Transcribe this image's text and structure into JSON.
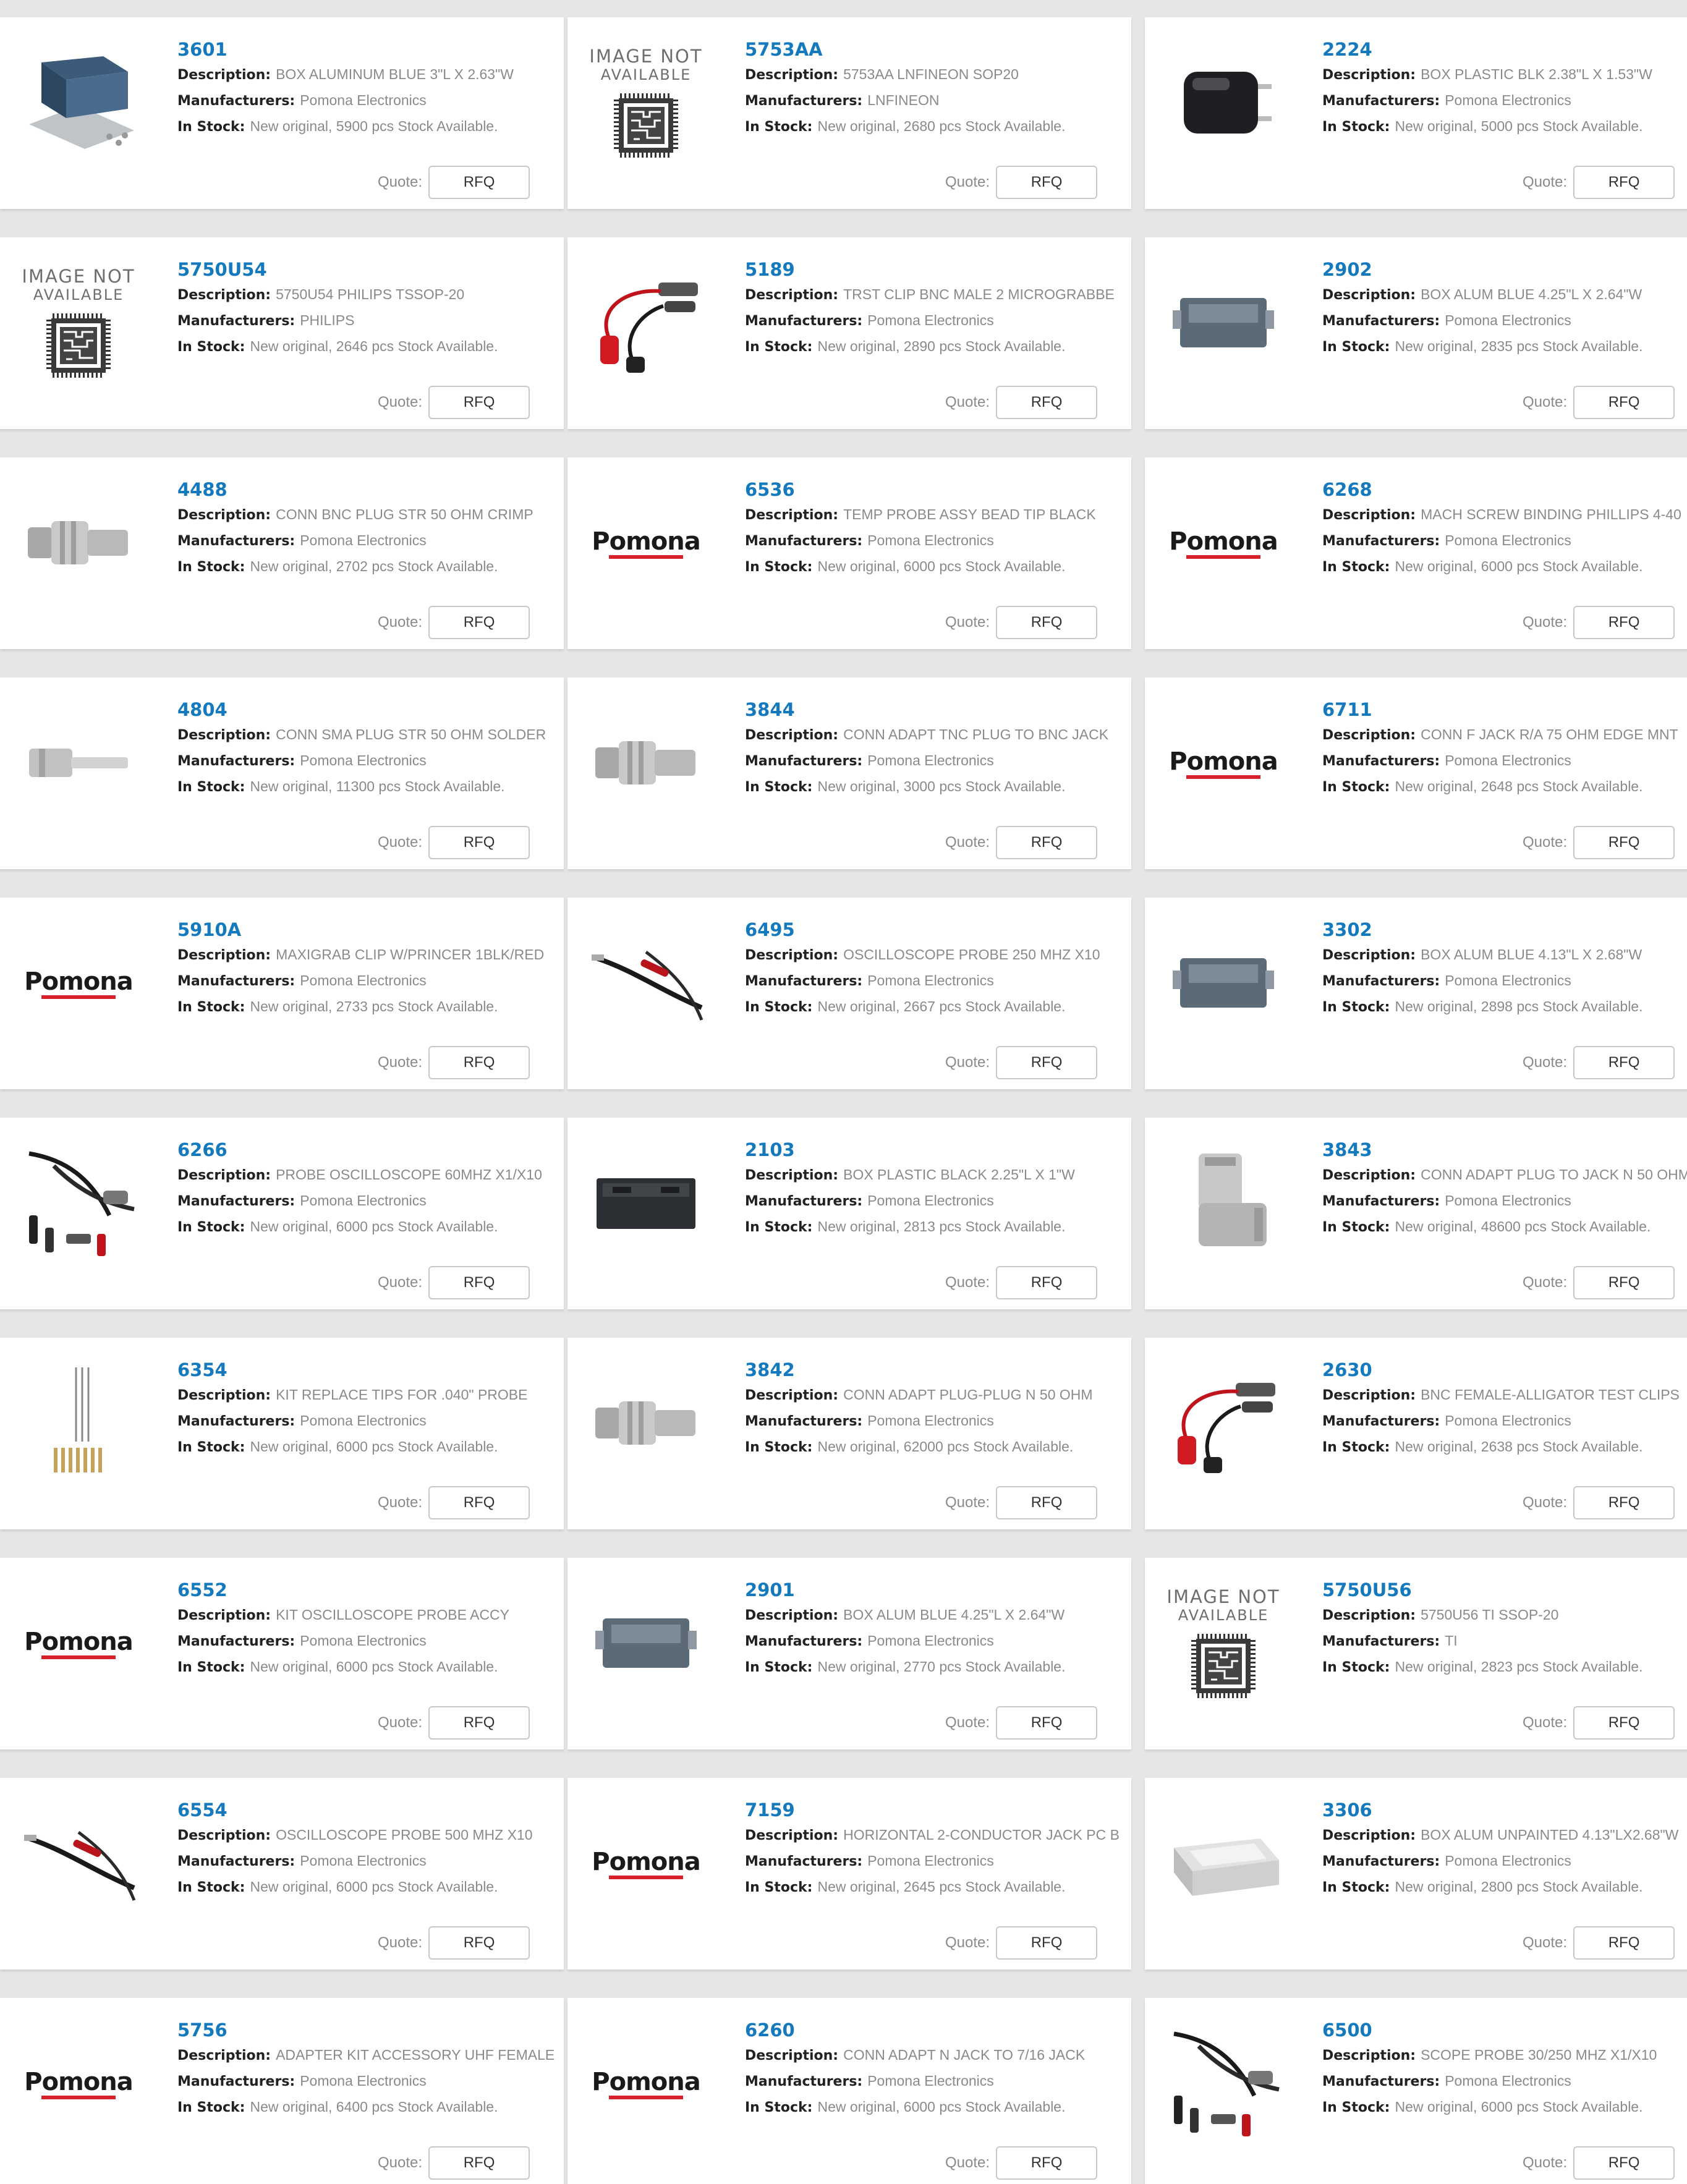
{
  "labels": {
    "description": "Description:",
    "manufacturers": "Manufacturers:",
    "in_stock": "In Stock:",
    "quote": "Quote:",
    "rfq": "RFQ"
  },
  "placeholders": {
    "image_not_available_line1": "IMAGE NOT",
    "image_not_available_line2": "AVAILABLE",
    "brand_logo": "Pomona"
  },
  "colors": {
    "part_number": "#1479bd",
    "logo_red": "#d6202a",
    "page_bg": "#e6e6e6"
  },
  "products": [
    {
      "pn": "3601",
      "desc": "BOX ALUMINUM BLUE 3\"L X 2.63\"W",
      "mfr": "Pomona Electronics",
      "stock": "New original, 5900 pcs Stock Available.",
      "img": "box-blue"
    },
    {
      "pn": "5753AA",
      "desc": "5753AA LNFINEON SOP20",
      "mfr": "LNFINEON",
      "stock": "New original, 2680 pcs Stock Available.",
      "img": "na"
    },
    {
      "pn": "2224",
      "desc": "BOX PLASTIC BLK 2.38\"L X 1.53\"W",
      "mfr": "Pomona Electronics",
      "stock": "New original, 5000 pcs Stock Available.",
      "img": "box-black-small"
    },
    {
      "pn": "5750U54",
      "desc": "5750U54 PHILIPS TSSOP-20",
      "mfr": "PHILIPS",
      "stock": "New original, 2646 pcs Stock Available.",
      "img": "na"
    },
    {
      "pn": "5189",
      "desc": "TRST CLIP BNC MALE 2 MICROGRABBE",
      "mfr": "Pomona Electronics",
      "stock": "New original, 2890 pcs Stock Available.",
      "img": "clip-cable"
    },
    {
      "pn": "2902",
      "desc": "BOX ALUM BLUE 4.25\"L X 2.64\"W",
      "mfr": "Pomona Electronics",
      "stock": "New original, 2835 pcs Stock Available.",
      "img": "box-gray"
    },
    {
      "pn": "4488",
      "desc": "CONN BNC PLUG STR 50 OHM CRIMP",
      "mfr": "Pomona Electronics",
      "stock": "New original, 2702 pcs Stock Available.",
      "img": "connector-h"
    },
    {
      "pn": "6536",
      "desc": "TEMP PROBE ASSY BEAD TIP BLACK",
      "mfr": "Pomona Electronics",
      "stock": "New original, 6000 pcs Stock Available.",
      "img": "logo"
    },
    {
      "pn": "6268",
      "desc": "MACH SCREW BINDING PHILLIPS 4-40",
      "mfr": "Pomona Electronics",
      "stock": "New original, 6000 pcs Stock Available.",
      "img": "logo"
    },
    {
      "pn": "4804",
      "desc": "CONN SMA PLUG STR 50 OHM SOLDER",
      "mfr": "Pomona Electronics",
      "stock": "New original, 11300 pcs Stock Available.",
      "img": "connector-small"
    },
    {
      "pn": "3844",
      "desc": "CONN ADAPT TNC PLUG TO BNC JACK",
      "mfr": "Pomona Electronics",
      "stock": "New original, 3000 pcs Stock Available.",
      "img": "connector-h"
    },
    {
      "pn": "6711",
      "desc": "CONN F JACK R/A 75 OHM EDGE MNT",
      "mfr": "Pomona Electronics",
      "stock": "New original, 2648 pcs Stock Available.",
      "img": "logo"
    },
    {
      "pn": "5910A",
      "desc": "MAXIGRAB CLIP W/PRINCER 1BLK/RED",
      "mfr": "Pomona Electronics",
      "stock": "New original, 2733 pcs Stock Available.",
      "img": "logo"
    },
    {
      "pn": "6495",
      "desc": "OSCILLOSCOPE PROBE 250 MHZ X10",
      "mfr": "Pomona Electronics",
      "stock": "New original, 2667 pcs Stock Available.",
      "img": "probe"
    },
    {
      "pn": "3302",
      "desc": "BOX ALUM BLUE 4.13\"L X 2.68\"W",
      "mfr": "Pomona Electronics",
      "stock": "New original, 2898 pcs Stock Available.",
      "img": "box-gray"
    },
    {
      "pn": "6266",
      "desc": "PROBE OSCILLOSCOPE 60MHZ X1/X10",
      "mfr": "Pomona Electronics",
      "stock": "New original, 6000 pcs Stock Available.",
      "img": "probe-kit"
    },
    {
      "pn": "2103",
      "desc": "BOX PLASTIC BLACK 2.25\"L X 1\"W",
      "mfr": "Pomona Electronics",
      "stock": "New original, 2813 pcs Stock Available.",
      "img": "box-black"
    },
    {
      "pn": "3843",
      "desc": "CONN ADAPT PLUG TO JACK N 50 OHM",
      "mfr": "Pomona Electronics",
      "stock": "New original, 48600 pcs Stock Available.",
      "img": "elbow"
    },
    {
      "pn": "6354",
      "desc": "KIT REPLACE TIPS FOR .040\" PROBE",
      "mfr": "Pomona Electronics",
      "stock": "New original, 6000 pcs Stock Available.",
      "img": "tips"
    },
    {
      "pn": "3842",
      "desc": "CONN ADAPT PLUG-PLUG N 50 OHM",
      "mfr": "Pomona Electronics",
      "stock": "New original, 62000 pcs Stock Available.",
      "img": "connector-h"
    },
    {
      "pn": "2630",
      "desc": "BNC FEMALE-ALLIGATOR TEST CLIPS",
      "mfr": "Pomona Electronics",
      "stock": "New original, 2638 pcs Stock Available.",
      "img": "clip-cable"
    },
    {
      "pn": "6552",
      "desc": "KIT OSCILLOSCOPE PROBE ACCY",
      "mfr": "Pomona Electronics",
      "stock": "New original, 6000 pcs Stock Available.",
      "img": "logo"
    },
    {
      "pn": "2901",
      "desc": "BOX ALUM BLUE 4.25\"L X 2.64\"W",
      "mfr": "Pomona Electronics",
      "stock": "New original, 2770 pcs Stock Available.",
      "img": "box-gray"
    },
    {
      "pn": "5750U56",
      "desc": "5750U56 TI SSOP-20",
      "mfr": "TI",
      "stock": "New original, 2823 pcs Stock Available.",
      "img": "na"
    },
    {
      "pn": "6554",
      "desc": "OSCILLOSCOPE PROBE 500 MHZ X10",
      "mfr": "Pomona Electronics",
      "stock": "New original, 6000 pcs Stock Available.",
      "img": "probe"
    },
    {
      "pn": "7159",
      "desc": "HORIZONTAL 2-CONDUCTOR JACK PC B",
      "mfr": "Pomona Electronics",
      "stock": "New original, 2645 pcs Stock Available.",
      "img": "logo"
    },
    {
      "pn": "3306",
      "desc": "BOX ALUM UNPAINTED 4.13\"LX2.68\"W",
      "mfr": "Pomona Electronics",
      "stock": "New original, 2800 pcs Stock Available.",
      "img": "box-silver"
    },
    {
      "pn": "5756",
      "desc": "ADAPTER KIT ACCESSORY UHF FEMALE",
      "mfr": "Pomona Electronics",
      "stock": "New original, 6400 pcs Stock Available.",
      "img": "logo"
    },
    {
      "pn": "6260",
      "desc": "CONN ADAPT N JACK TO 7/16 JACK",
      "mfr": "Pomona Electronics",
      "stock": "New original, 6000 pcs Stock Available.",
      "img": "logo"
    },
    {
      "pn": "6500",
      "desc": "SCOPE PROBE 30/250 MHZ X1/X10",
      "mfr": "Pomona Electronics",
      "stock": "New original, 6000 pcs Stock Available.",
      "img": "probe-kit"
    }
  ]
}
